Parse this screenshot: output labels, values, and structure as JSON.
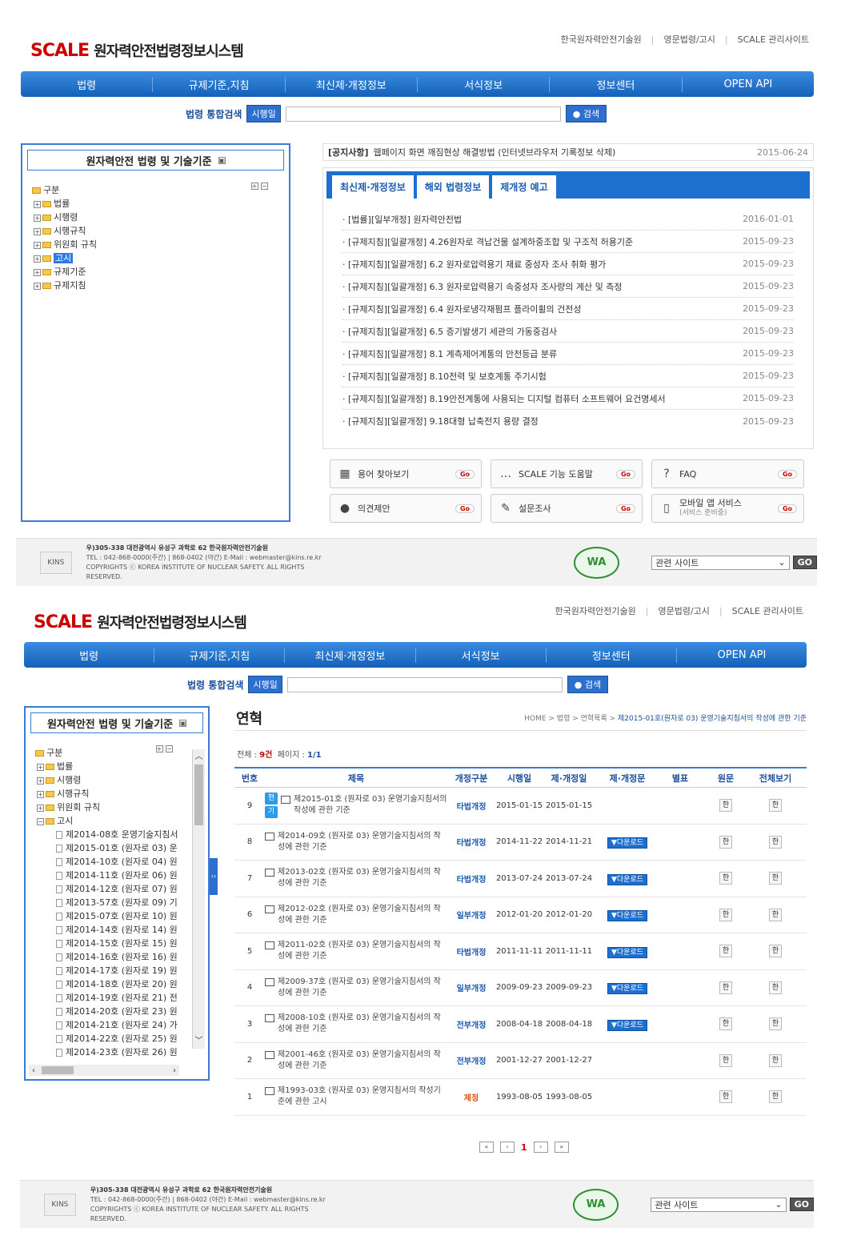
{
  "header": {
    "logo": "SCALE",
    "logo_sub": "원자력안전법령정보시스템",
    "util_links": [
      "한국원자력안전기술원",
      "영문법령/고시",
      "SCALE 관리사이트"
    ]
  },
  "gnb": [
    "법령",
    "규제기준,지침",
    "최신제·개정정보",
    "서식정보",
    "정보센터",
    "OPEN API"
  ],
  "search": {
    "label": "법령 통합검색",
    "chip": "시행일",
    "button": "검색"
  },
  "left_panel": {
    "title": "원자력안전 법령 및 기술기준",
    "root": "구분",
    "items": [
      "법률",
      "시행령",
      "시행규칙",
      "위원회 규칙",
      "고시",
      "규제기준",
      "규제지침"
    ]
  },
  "notice": {
    "tag": "[공지사항]",
    "text": "웹페이지 화면 깨짐현상 해결방법 (인터넷브라우저 기록정보 삭제)",
    "date": "2015-06-24"
  },
  "tabs": [
    "최신제·개정정보",
    "해외 법령정보",
    "제개정 예고"
  ],
  "news": [
    {
      "text": "[법률][일부개정] 원자력안전법",
      "date": "2016-01-01"
    },
    {
      "text": "[규제지침][일괄개정] 4.26원자로 격납건물 설계하중조합 및 구조적 허용기준",
      "date": "2015-09-23"
    },
    {
      "text": "[규제지침][일괄개정] 6.2 원자로압력용기 재료 중성자 조사 취화 평가",
      "date": "2015-09-23"
    },
    {
      "text": "[규제지침][일괄개정] 6.3 원자로압력용기 속중성자 조사량의 계산 및 측정",
      "date": "2015-09-23"
    },
    {
      "text": "[규제지침][일괄개정] 6.4 원자로냉각재펌프 플라이휠의 건전성",
      "date": "2015-09-23"
    },
    {
      "text": "[규제지침][일괄개정] 6.5 증기발생기 세관의 가동중검사",
      "date": "2015-09-23"
    },
    {
      "text": "[규제지침][일괄개정] 8.1 계측제어계통의 안전등급 분류",
      "date": "2015-09-23"
    },
    {
      "text": "[규제지침][일괄개정] 8.10전력 및 보호계통 주기시험",
      "date": "2015-09-23"
    },
    {
      "text": "[규제지침][일괄개정] 8.19안전계통에 사용되는 디지털 컴퓨터 소프트웨어 요건명세서",
      "date": "2015-09-23"
    },
    {
      "text": "[규제지침][일괄개정] 9.18대형 납축전지 용량 결정",
      "date": "2015-09-23"
    }
  ],
  "quick": [
    {
      "label": "용어 찾아보기",
      "go": "Go",
      "icon": "dictionary-icon"
    },
    {
      "label": "SCALE 기능 도움말",
      "go": "Go",
      "icon": "help-icon"
    },
    {
      "label": "FAQ",
      "go": "Go",
      "icon": "faq-icon"
    },
    {
      "label": "의견제안",
      "go": "Go",
      "icon": "opinion-icon"
    },
    {
      "label": "설문조사",
      "go": "Go",
      "icon": "survey-icon"
    },
    {
      "label": "모바일 앱 서비스",
      "sub": "(서비스 준비중)",
      "go": "Go",
      "icon": "mobile-icon"
    }
  ],
  "footer": {
    "logo": "KINS",
    "address": "우)305-338 대전광역시 유성구 과학로 62 한국원자력안전기술원",
    "tel": "TEL : 042-868-0000(주간) | 868-0402 (야간)    E-Mail : webmaster@kins.re.kr",
    "copyright": "COPYRIGHTS ⓒ KOREA INSTITUTE OF NUCLEAR SAFETY. ALL RIGHTS RESERVED.",
    "wa_mark": "WA",
    "related": "관련 사이트",
    "go": "GO"
  },
  "page2": {
    "title": "연혁",
    "breadcrumb": [
      "HOME",
      "법령",
      "연혁목록",
      "제2015-01호(원자로 03) 운영기술지침서의 작성에 관한 기준"
    ],
    "count_label": "전체 : ",
    "count": "9건",
    "page_label": "페이지 : ",
    "page": "1/1",
    "tree_root": "구분",
    "tree_top": [
      "법률",
      "시행령",
      "시행규칙",
      "위원회 규칙",
      "고시"
    ],
    "tree_docs": [
      "제2014-08호 운영기술지침서",
      "제2015-01호 (원자로 03) 운",
      "제2014-10호 (원자로 04) 원",
      "제2014-11호 (원자로 06) 원",
      "제2014-12호 (원자로 07) 원",
      "제2013-57호 (원자로 09) 기",
      "제2015-07호 (원자로 10) 원",
      "제2014-14호 (원자로 14) 원",
      "제2014-15호 (원자로 15) 원",
      "제2014-16호 (원자로 16) 원",
      "제2014-17호 (원자로 19) 원",
      "제2014-18호 (원자로 20) 원",
      "제2014-19호 (원자로 21) 전",
      "제2014-20호 (원자로 23) 원",
      "제2014-21호 (원자로 24) 가",
      "제2014-22호 (원자로 25) 원",
      "제2014-23호 (원자로 26) 원"
    ],
    "columns": [
      "번호",
      "제목",
      "개정구분",
      "시행일",
      "제·개정일",
      "제·개정문",
      "별표",
      "원문",
      "전체보기"
    ],
    "rows": [
      {
        "no": "9",
        "title": "제2015-01호 (원자로 03) 운영기술지침서의 작성에 관한 기준",
        "type": "타법개정",
        "eff": "2015-01-15",
        "rev": "2015-01-15",
        "doc": "",
        "badge1": "현",
        "badge2": "기",
        "orig": "한",
        "full": "한"
      },
      {
        "no": "8",
        "title": "제2014-09호 (원자로 03) 운영기술지침서의 작성에 관한 기준",
        "type": "타법개정",
        "eff": "2014-11-22",
        "rev": "2014-11-21",
        "doc": "다운로드",
        "orig": "한",
        "full": "한"
      },
      {
        "no": "7",
        "title": "제2013-02호 (원자로 03) 운영기술지침서의 작성에 관한 기준",
        "type": "타법개정",
        "eff": "2013-07-24",
        "rev": "2013-07-24",
        "doc": "다운로드",
        "orig": "한",
        "full": "한"
      },
      {
        "no": "6",
        "title": "제2012-02호 (원자로 03) 운영기술지침서의 작성에 관한 기준",
        "type": "일부개정",
        "eff": "2012-01-20",
        "rev": "2012-01-20",
        "doc": "다운로드",
        "orig": "한",
        "full": "한"
      },
      {
        "no": "5",
        "title": "제2011-02호 (원자로 03) 운영기술지침서의 작성에 관한 기준",
        "type": "타법개정",
        "eff": "2011-11-11",
        "rev": "2011-11-11",
        "doc": "다운로드",
        "orig": "한",
        "full": "한"
      },
      {
        "no": "4",
        "title": "제2009-37호 (원자로 03) 운영기술지침서의 작성에 관한 기준",
        "type": "일부개정",
        "eff": "2009-09-23",
        "rev": "2009-09-23",
        "doc": "다운로드",
        "orig": "한",
        "full": "한"
      },
      {
        "no": "3",
        "title": "제2008-10호 (원자로 03) 운영기술지침서의 작성에 관한 기준",
        "type": "전부개정",
        "eff": "2008-04-18",
        "rev": "2008-04-18",
        "doc": "다운로드",
        "orig": "한",
        "full": "한"
      },
      {
        "no": "2",
        "title": "제2001-46호 (원자로 03) 운영기술지침서의 작성에 관한 기준",
        "type": "전부개정",
        "eff": "2001-12-27",
        "rev": "2001-12-27",
        "doc": "",
        "orig": "한",
        "full": "한"
      },
      {
        "no": "1",
        "title": "제1993-03호 (원자로 03) 운영지침서의 작성기준에 관한 고시",
        "type": "제정",
        "eff": "1993-08-05",
        "rev": "1993-08-05",
        "doc": "",
        "orig": "한",
        "full": "한"
      }
    ],
    "pager": {
      "first": "«",
      "prev": "‹",
      "current": "1",
      "next": "›",
      "last": "»"
    }
  }
}
